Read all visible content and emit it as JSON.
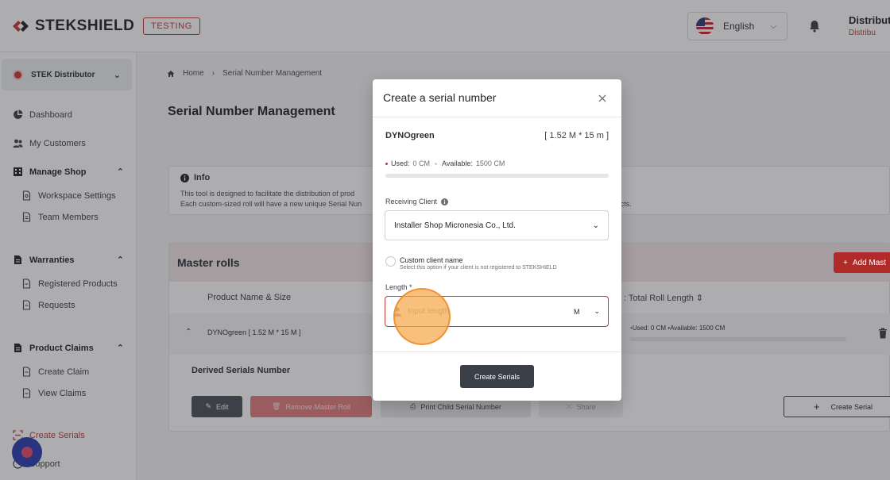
{
  "header": {
    "brand": "STEKSHIELD",
    "env_badge": "TESTING",
    "language": "English",
    "user_name": "Distribut",
    "user_role": "Distribu"
  },
  "sidebar": {
    "org_name": "STEK Distributor",
    "items": [
      {
        "label": "Dashboard"
      },
      {
        "label": "My Customers"
      },
      {
        "label": "Manage Shop"
      },
      {
        "label": "Workspace Settings"
      },
      {
        "label": "Team Members"
      },
      {
        "label": "Warranties"
      },
      {
        "label": "Registered Products"
      },
      {
        "label": "Requests"
      },
      {
        "label": "Product Claims"
      },
      {
        "label": "Create Claim"
      },
      {
        "label": "View Claims"
      },
      {
        "label": "Create Serials"
      },
      {
        "label": "Support"
      }
    ]
  },
  "main": {
    "breadcrumb": {
      "home": "Home",
      "current": "Serial Number Management"
    },
    "title": "Serial Number Management",
    "info": {
      "title": "Info",
      "line1": "This tool is designed to facilitate the distribution of prod                                                                          ustom-sized rolls for sale.",
      "line2": "Each custom-sized roll will have a new unique Serial Nun                                                                          register warranties and claim products."
    },
    "master_rolls": {
      "title": "Master rolls",
      "add_label": "Add Mast",
      "col_product": "Product Name & Size",
      "col_total": ": Total Roll Length",
      "row_name": "DYNOgreen [ 1.52 M * 15 M ]",
      "row_used": "Used: 0 CM",
      "row_available": "Available: 1500 CM",
      "derived_title": "Derived Serials Number",
      "btn_edit": "Edit",
      "btn_remove": "Remove Master Roll",
      "btn_print": "Print Child Serial Number",
      "btn_share": "Share",
      "btn_create_serial": "Create Serial"
    }
  },
  "modal": {
    "title": "Create a serial number",
    "product_name": "DYNOgreen",
    "product_size": "[ 1.52 M * 15 m ]",
    "used_label": "Used:",
    "used_value": "0 CM",
    "available_label": "Available:",
    "available_value": "1500 CM",
    "used_fraction": 0,
    "receiving_client_label": "Receiving Client",
    "receiving_client_value": "Installer Shop Micronesia Co., Ltd.",
    "custom_name_label": "Custom client name",
    "custom_name_help": "Select this option if your client is not registered to STEKSHIELD",
    "length_label": "Length *",
    "length_placeholder": "Input length",
    "length_unit": "M",
    "submit_label": "Create Serials"
  },
  "colors": {
    "brand_red": "#c23a3a",
    "dark_button": "#3a3f48",
    "click_indicator": "#f6a64a"
  }
}
